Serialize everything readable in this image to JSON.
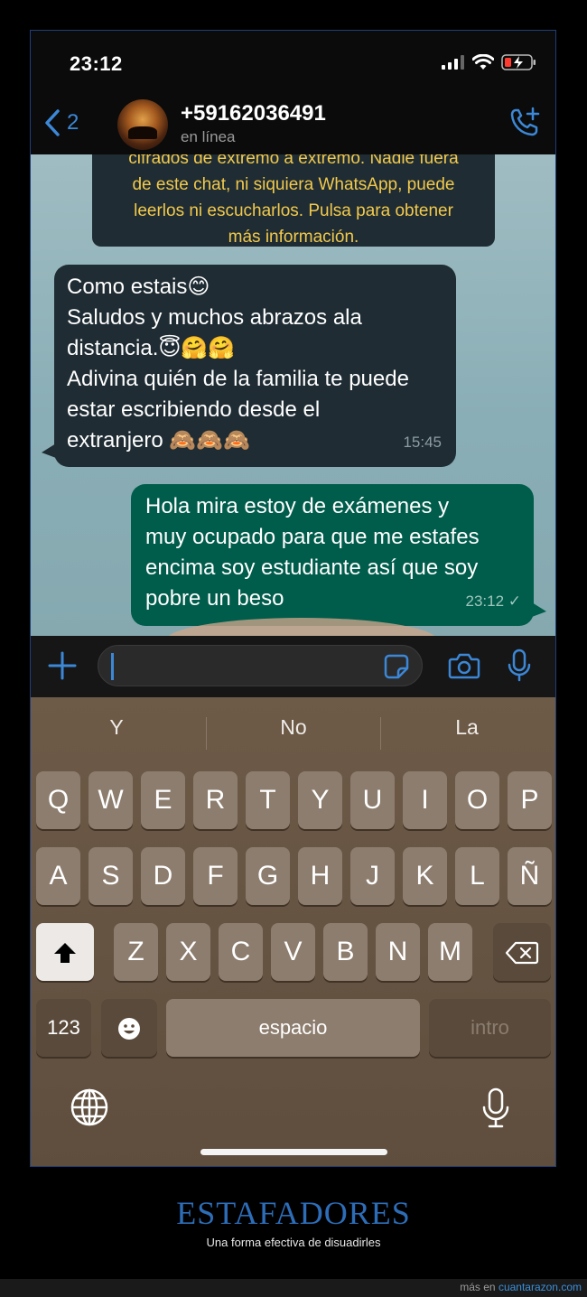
{
  "status_bar": {
    "time": "23:12"
  },
  "header": {
    "back_count": "2",
    "contact_name": "+59162036491",
    "contact_status": "en línea"
  },
  "notice": {
    "lines": [
      "cifrados de extremo a extremo. Nadie fuera",
      "de este chat, ni siquiera WhatsApp, puede",
      "leerlos ni escucharlos. Pulsa para obtener",
      "más información."
    ]
  },
  "messages": [
    {
      "direction": "incoming",
      "lines": [
        "Como estais😊",
        "Saludos y muchos abrazos  ala",
        "distancia.😇🤗🤗",
        "Adivina quién de la familia te puede",
        "estar escribiendo desde el",
        "extranjero 🙈🙈🙈"
      ],
      "time": "15:45"
    },
    {
      "direction": "outgoing",
      "lines": [
        "Hola mira estoy de exámenes y",
        "muy ocupado para que me estafes",
        "encima soy estudiante así que soy",
        "pobre un beso"
      ],
      "time": "23:12 ✓"
    }
  ],
  "input": {
    "placeholder": ""
  },
  "keyboard": {
    "suggestions": [
      "Y",
      "No",
      "La"
    ],
    "row1": [
      "Q",
      "W",
      "E",
      "R",
      "T",
      "Y",
      "U",
      "I",
      "O",
      "P"
    ],
    "row2": [
      "A",
      "S",
      "D",
      "F",
      "G",
      "H",
      "J",
      "K",
      "L",
      "Ñ"
    ],
    "row3": [
      "Z",
      "X",
      "C",
      "V",
      "B",
      "N",
      "M"
    ],
    "numbers_label": "123",
    "space_label": "espacio",
    "return_label": "intro"
  },
  "caption": {
    "title": "ESTAFADORES",
    "subtitle": "Una forma efectiva de disuadirles"
  },
  "footer": {
    "prefix": "más en ",
    "link": "cuantarazon.com"
  },
  "colors": {
    "accent": "#3c87d6",
    "incoming_bubble": "#1f2c33",
    "outgoing_bubble": "#005c4b",
    "notice_text": "#f2c94c",
    "caption_title": "#2d6db8"
  }
}
